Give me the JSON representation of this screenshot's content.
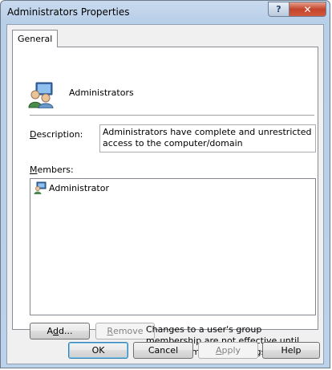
{
  "window": {
    "title": "Administrators Properties",
    "help_glyph": "?",
    "close_glyph": "✕"
  },
  "tabs": [
    {
      "label": "General"
    }
  ],
  "group": {
    "name": "Administrators",
    "icon": "user-group-icon"
  },
  "description": {
    "label_first": "D",
    "label_rest": "escription:",
    "value": "Administrators have complete and unrestricted access to the computer/domain"
  },
  "members": {
    "label_first": "M",
    "label_rest": "embers:",
    "items": [
      {
        "name": "Administrator",
        "icon": "user-icon"
      }
    ]
  },
  "buttons": {
    "add": {
      "pre": "A",
      "ul": "d",
      "post": "d..."
    },
    "remove": {
      "pre": "",
      "ul": "R",
      "post": "emove"
    },
    "ok": "OK",
    "cancel": "Cancel",
    "apply": {
      "pre": "",
      "ul": "A",
      "post": "pply"
    },
    "help": "Help"
  },
  "note": "Changes to a user's group membership are not effective until the next time the user logs on."
}
